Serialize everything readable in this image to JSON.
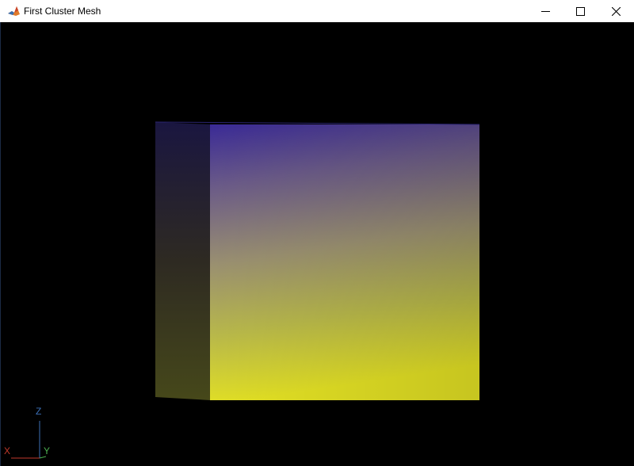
{
  "window": {
    "title": "First Cluster Mesh",
    "app_icon": "matlab-icon",
    "controls": {
      "minimize_icon": "minimize-icon",
      "maximize_icon": "maximize-icon",
      "close_icon": "close-icon"
    }
  },
  "viewport": {
    "background_color": "#000000",
    "mesh": {
      "front_face_top_color": "#3a2a96",
      "front_face_bottom_color": "#e2e024",
      "side_face_top_color": "#1a1640",
      "side_face_bottom_color": "#46481a"
    },
    "orientation_axes": {
      "x_label": "X",
      "y_label": "Y",
      "z_label": "Z",
      "x_color": "#c0392b",
      "y_color": "#4caf50",
      "z_color": "#3b6fb6"
    }
  }
}
